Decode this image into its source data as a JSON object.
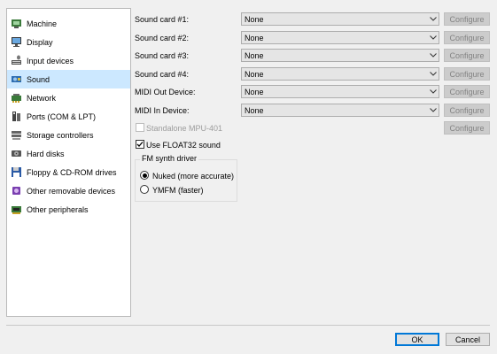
{
  "sidebar": {
    "items": [
      {
        "label": "Machine",
        "icon": "machine-icon"
      },
      {
        "label": "Display",
        "icon": "display-icon"
      },
      {
        "label": "Input devices",
        "icon": "input-devices-icon"
      },
      {
        "label": "Sound",
        "icon": "sound-icon",
        "selected": true
      },
      {
        "label": "Network",
        "icon": "network-icon"
      },
      {
        "label": "Ports (COM & LPT)",
        "icon": "ports-icon"
      },
      {
        "label": "Storage controllers",
        "icon": "storage-controllers-icon"
      },
      {
        "label": "Hard disks",
        "icon": "hard-disk-icon"
      },
      {
        "label": "Floppy & CD-ROM drives",
        "icon": "floppy-icon"
      },
      {
        "label": "Other removable devices",
        "icon": "removable-device-icon"
      },
      {
        "label": "Other peripherals",
        "icon": "peripherals-icon"
      }
    ]
  },
  "sound": {
    "rows": [
      {
        "label": "Sound card #1:",
        "value": "None",
        "configure": "Configure"
      },
      {
        "label": "Sound card #2:",
        "value": "None",
        "configure": "Configure"
      },
      {
        "label": "Sound card #3:",
        "value": "None",
        "configure": "Configure"
      },
      {
        "label": "Sound card #4:",
        "value": "None",
        "configure": "Configure"
      },
      {
        "label": "MIDI Out Device:",
        "value": "None",
        "configure": "Configure"
      },
      {
        "label": "MIDI In Device:",
        "value": "None",
        "configure": "Configure"
      }
    ],
    "standalone_mpu": {
      "label": "Standalone MPU-401",
      "checked": false,
      "configure": "Configure"
    },
    "float32": {
      "label": "Use FLOAT32 sound",
      "checked": true
    },
    "fm_synth": {
      "title": "FM synth driver",
      "options": [
        {
          "label": "Nuked (more accurate)",
          "selected": true
        },
        {
          "label": "YMFM (faster)",
          "selected": false
        }
      ]
    }
  },
  "footer": {
    "ok_label": "OK",
    "cancel_label": "Cancel"
  },
  "colors": {
    "selection": "#cce8ff",
    "accent": "#0078d7"
  }
}
